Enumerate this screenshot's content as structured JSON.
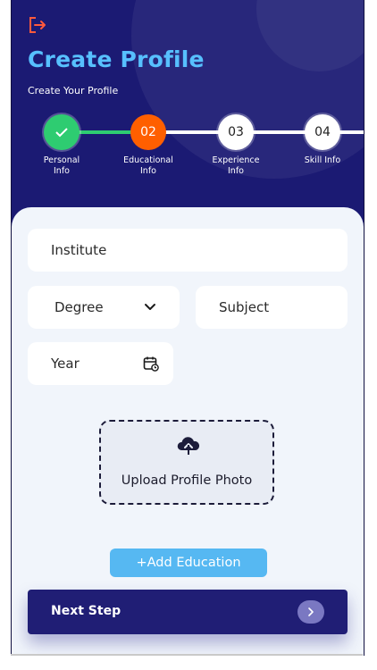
{
  "header": {
    "title": "Create Profile",
    "subtitle": "Create Your Profile",
    "logout_icon": "logout-icon"
  },
  "steps": [
    {
      "label_line1": "Personal",
      "label_line2": "Info",
      "number": "",
      "state": "done",
      "icon": "check-icon"
    },
    {
      "label_line1": "Educational",
      "label_line2": "Info",
      "number": "02",
      "state": "active"
    },
    {
      "label_line1": "Experience",
      "label_line2": "Info",
      "number": "03",
      "state": "pending"
    },
    {
      "label_line1": "Skill Info",
      "label_line2": "",
      "number": "04",
      "state": "pending"
    }
  ],
  "form": {
    "institute": "Institute",
    "degree": "Degree",
    "subject": "Subject",
    "year": "Year"
  },
  "upload": {
    "label": "Upload Profile Photo",
    "icon": "cloud-upload-icon"
  },
  "actions": {
    "add_education": "+Add Education",
    "next_step": "Next Step"
  },
  "colors": {
    "header_bg": "#1b1a73",
    "title": "#57c0ff",
    "step_done": "#2ecc71",
    "step_active": "#ff5f00",
    "add_button": "#56b8f2",
    "next_button": "#201e75",
    "logout_icon": "#ff5a3c"
  }
}
